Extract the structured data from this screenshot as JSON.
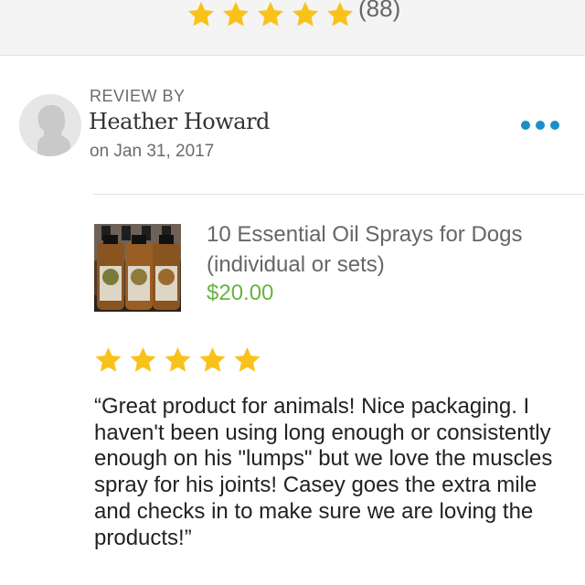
{
  "rating_summary": {
    "stars": 5,
    "count_text": "(88)",
    "star_color": "#f9c21a"
  },
  "review": {
    "label": "REVIEW BY",
    "reviewer": "Heather Howard",
    "date": "on Jan 31, 2017",
    "more_icon": "more-dots-icon",
    "accent_color": "#1a8fc7",
    "product": {
      "title": "10 Essential Oil Sprays for Dogs (individual or sets)",
      "price": "$20.00",
      "price_color": "#67b344"
    },
    "rating": 5,
    "text": "“Great product for animals! Nice packaging. I haven't been using long enough or consistently enough on his \"lumps\" but we love the muscles spray for his joints! Casey goes the extra mile and checks in to make sure we are loving the products!”"
  }
}
